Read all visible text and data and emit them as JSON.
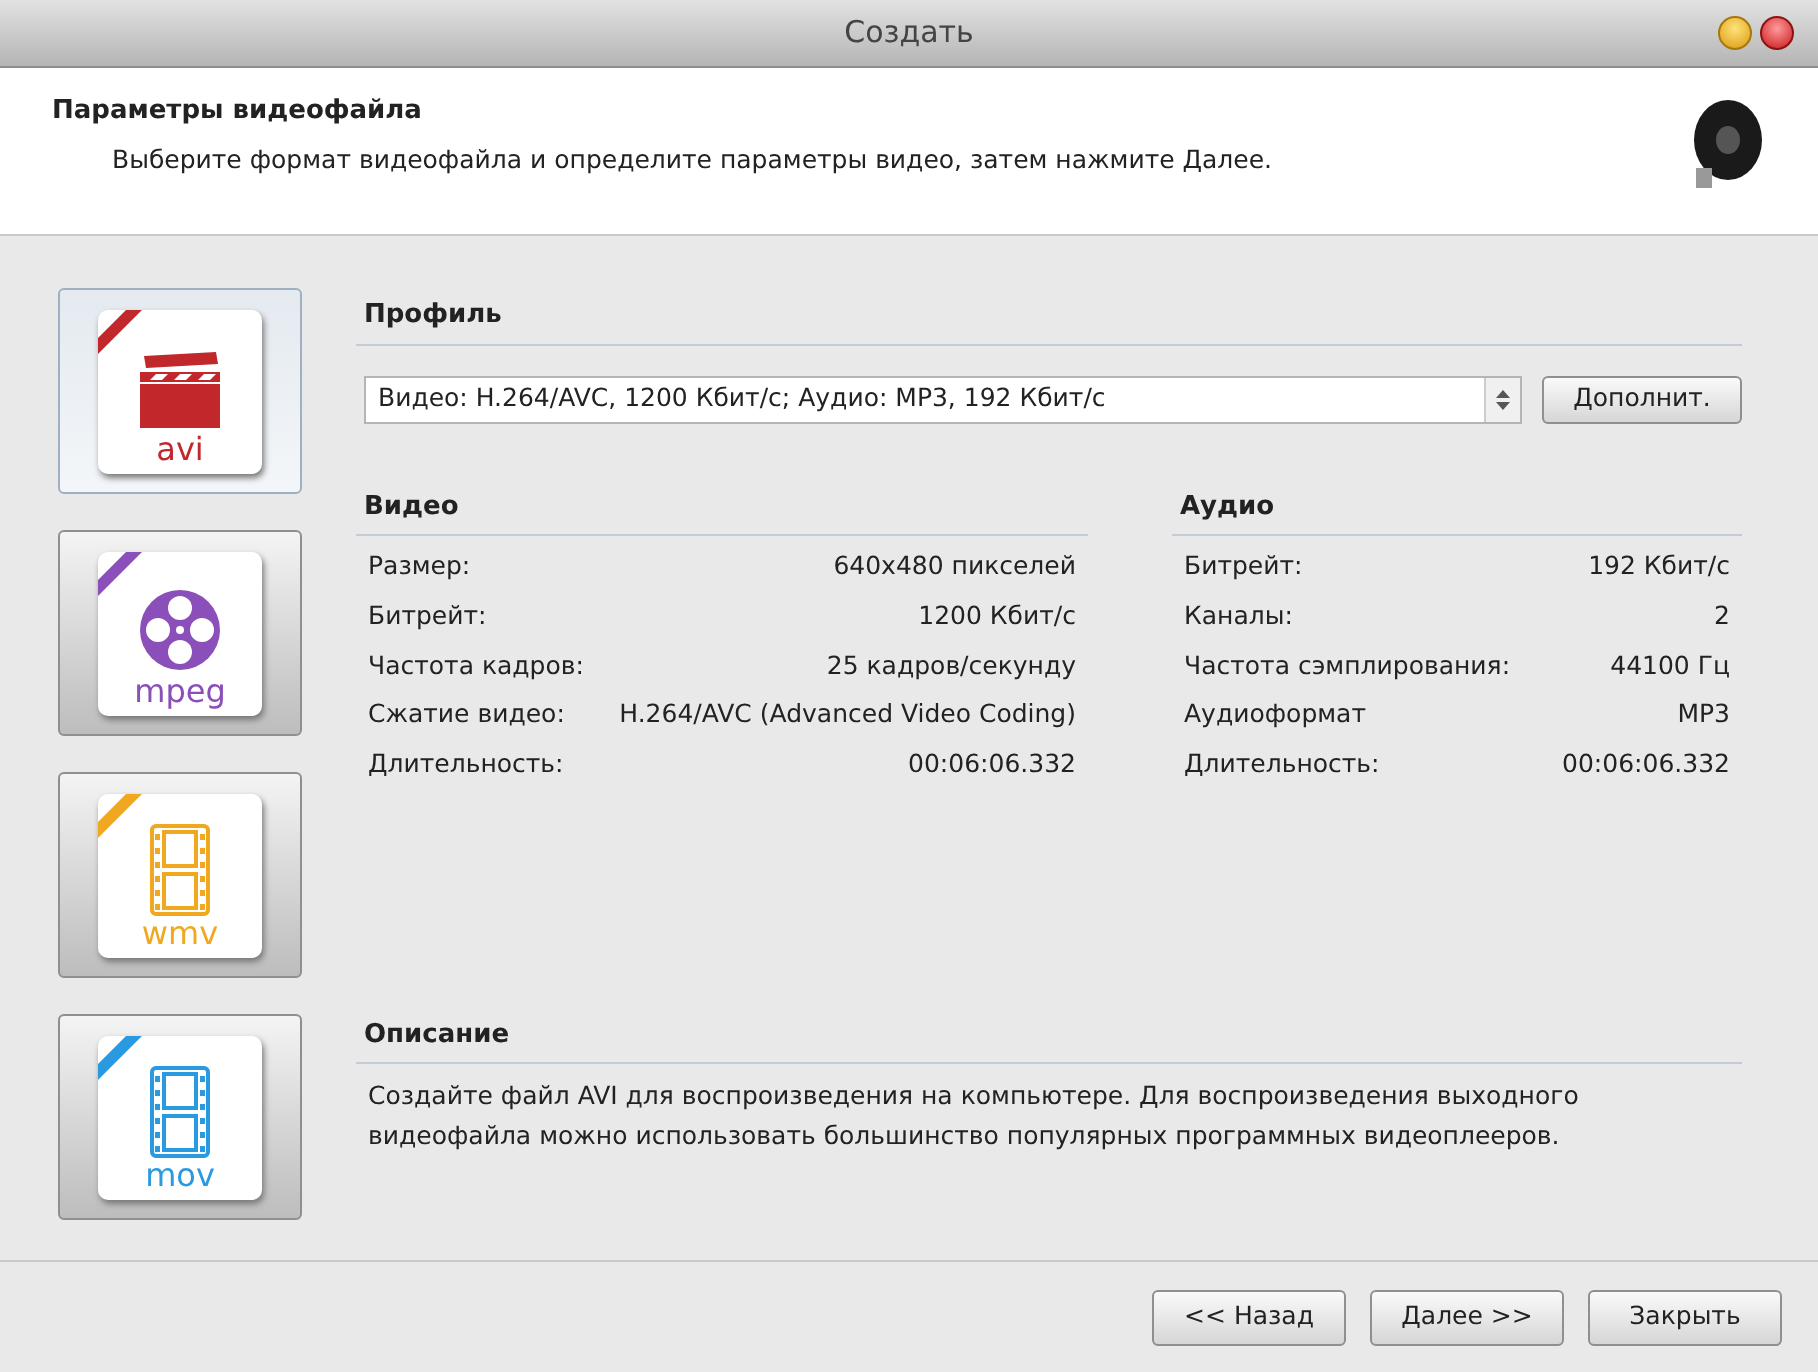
{
  "window": {
    "title": "Создать"
  },
  "header": {
    "title": "Параметры видеофайла",
    "subtitle": "Выберите формат видеофайла и определите параметры видео, затем нажмите Далее."
  },
  "formats": [
    {
      "label": "avi",
      "kind": "clapper",
      "color": "#c0282c",
      "selected": true
    },
    {
      "label": "mpeg",
      "kind": "reel",
      "color": "#8a4fb8",
      "selected": false
    },
    {
      "label": "wmv",
      "kind": "film",
      "color": "#f0a820",
      "selected": false
    },
    {
      "label": "mov",
      "kind": "film",
      "color": "#2a9ae0",
      "selected": false
    }
  ],
  "profile": {
    "heading": "Профиль",
    "value": "Видео: H.264/AVC, 1200 Кбит/с; Аудио: MP3, 192 Кбит/с",
    "button": "Дополнит."
  },
  "video": {
    "heading": "Видео",
    "rows": [
      {
        "label": "Размер:",
        "value": "640x480 пикселей"
      },
      {
        "label": "Битрейт:",
        "value": "1200 Кбит/с"
      },
      {
        "label": "Частота кадров:",
        "value": "25 кадров/секунду"
      },
      {
        "label": "Сжатие видео:",
        "value": "H.264/AVC (Advanced Video Coding)"
      },
      {
        "label": "Длительность:",
        "value": "00:06:06.332"
      }
    ]
  },
  "audio": {
    "heading": "Аудио",
    "rows": [
      {
        "label": "Битрейт:",
        "value": "192 Кбит/с"
      },
      {
        "label": "Каналы:",
        "value": "2"
      },
      {
        "label": "Частота сэмплирования:",
        "value": "44100 Гц"
      },
      {
        "label": "Аудиоформат",
        "value": "MP3"
      },
      {
        "label": "Длительность:",
        "value": "00:06:06.332"
      }
    ]
  },
  "description": {
    "heading": "Описание",
    "text": "Создайте файл AVI для воспроизведения на компьютере. Для воспроизведения выходного видеофайла можно использовать большинство популярных программных видеоплееров."
  },
  "buttons": [
    "<< Назад",
    "Далее >>",
    "Закрыть"
  ]
}
